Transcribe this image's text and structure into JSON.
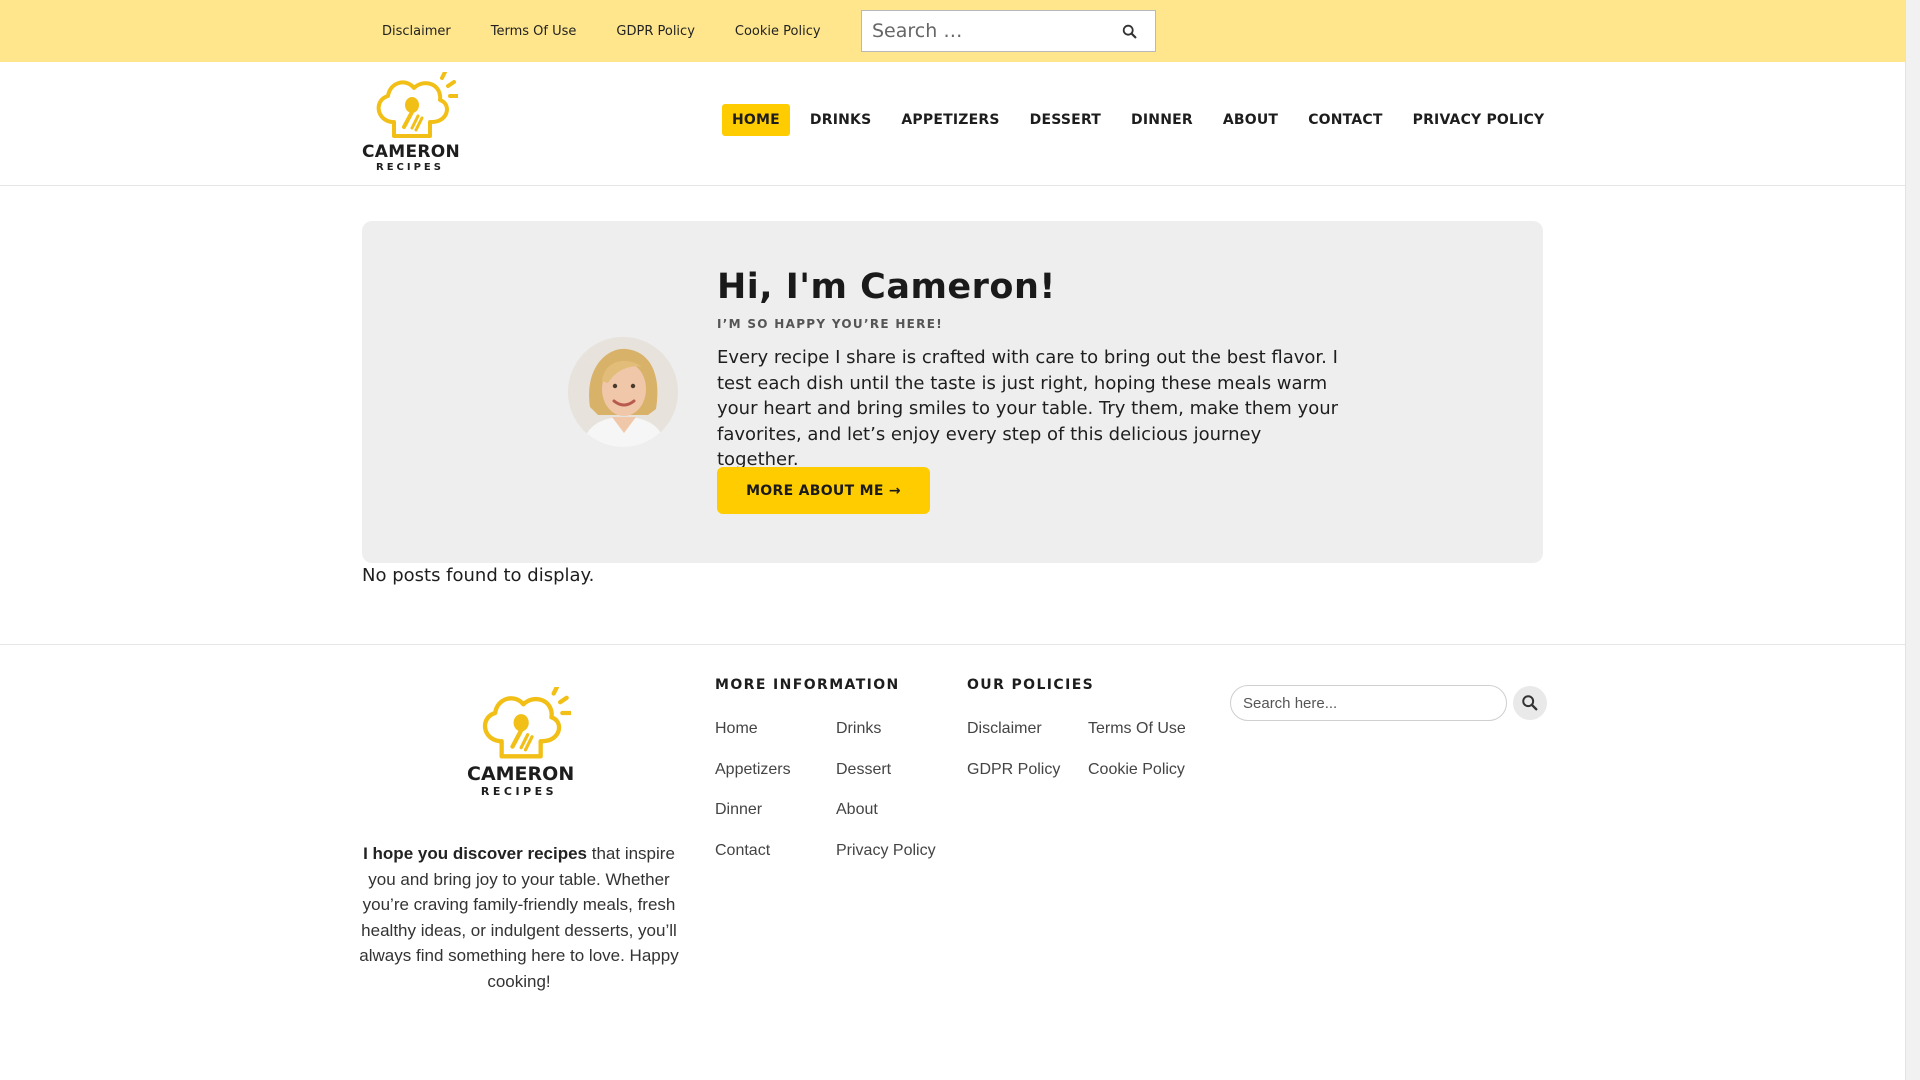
{
  "topbar": {
    "links": [
      "Disclaimer",
      "Terms Of Use",
      "GDPR Policy",
      "Cookie Policy"
    ],
    "search_placeholder": "Search …",
    "search_icon": "search-icon"
  },
  "brand": {
    "line1": "CAMERON",
    "line2": "RECIPES",
    "accent": "#ffcc00",
    "topbar_color": "#ffe68c"
  },
  "nav": {
    "items": [
      "HOME",
      "DRINKS",
      "APPETIZERS",
      "DESSERT",
      "DINNER",
      "ABOUT",
      "CONTACT",
      "PRIVACY POLICY"
    ],
    "active": "HOME"
  },
  "hero": {
    "title": "Hi, I'm Cameron!",
    "subtitle": "I’M SO HAPPY YOU’RE HERE!",
    "paragraph": "Every recipe I share is crafted with care to bring out the best flavor. I test each dish until the taste is just right, hoping these meals warm your heart and bring smiles to your table. Try them, make them your favorites, and let’s enjoy every step of this delicious journey together.",
    "button": "MORE ABOUT ME →"
  },
  "main": {
    "empty_message": "No posts found to display."
  },
  "footer": {
    "about_bold": "I hope you discover recipes",
    "about_rest": " that inspire you and bring joy to your table. Whether you’re craving family-friendly meals, fresh healthy ideas, or indulgent desserts, you’ll always find something here to love. Happy cooking!",
    "more_info_title": "MORE INFORMATION",
    "more_info_links": [
      "Home",
      "Drinks",
      "Appetizers",
      "Dessert",
      "Dinner",
      "About",
      "Contact",
      "Privacy Policy"
    ],
    "policies_title": "OUR POLICIES",
    "policies_links": [
      "Disclaimer",
      "Terms Of Use",
      "GDPR Policy",
      "Cookie Policy"
    ],
    "search_placeholder": "Search here..."
  }
}
